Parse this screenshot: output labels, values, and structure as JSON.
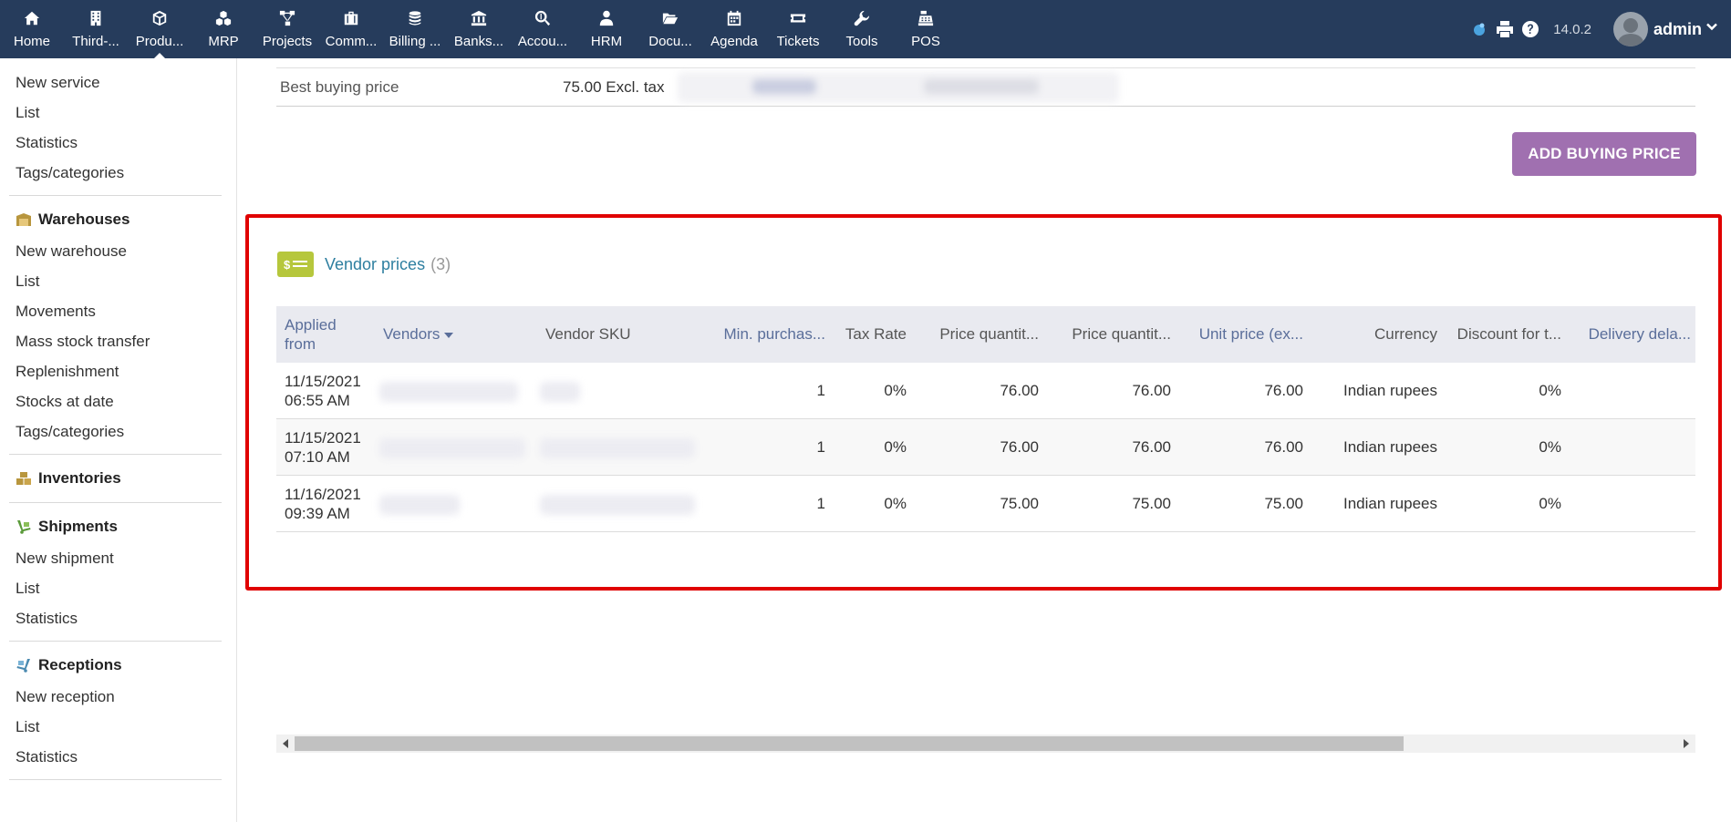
{
  "topbar": {
    "menu": [
      {
        "label": "Home",
        "icon": "home-icon"
      },
      {
        "label": "Third-...",
        "icon": "building-icon"
      },
      {
        "label": "Produ...",
        "icon": "cube-icon",
        "active": true
      },
      {
        "label": "MRP",
        "icon": "cubes-icon"
      },
      {
        "label": "Projects",
        "icon": "sitemap-icon"
      },
      {
        "label": "Comm...",
        "icon": "briefcase-icon"
      },
      {
        "label": "Billing ...",
        "icon": "coins-icon"
      },
      {
        "label": "Banks...",
        "icon": "bank-icon"
      },
      {
        "label": "Accou...",
        "icon": "search-dollar-icon"
      },
      {
        "label": "HRM",
        "icon": "user-tie-icon"
      },
      {
        "label": "Docu...",
        "icon": "folder-open-icon"
      },
      {
        "label": "Agenda",
        "icon": "calendar-icon"
      },
      {
        "label": "Tickets",
        "icon": "ticket-icon"
      },
      {
        "label": "Tools",
        "icon": "wrench-icon"
      },
      {
        "label": "POS",
        "icon": "cash-register-icon"
      }
    ],
    "version": "14.0.2",
    "username": "admin"
  },
  "sidebar": {
    "products": [
      "New service",
      "List",
      "Statistics",
      "Tags/categories"
    ],
    "warehouses": {
      "title": "Warehouses",
      "items": [
        "New warehouse",
        "List",
        "Movements",
        "Mass stock transfer",
        "Replenishment",
        "Stocks at date",
        "Tags/categories"
      ]
    },
    "inventories": {
      "title": "Inventories"
    },
    "shipments": {
      "title": "Shipments",
      "items": [
        "New shipment",
        "List",
        "Statistics"
      ]
    },
    "receptions": {
      "title": "Receptions",
      "items": [
        "New reception",
        "List",
        "Statistics"
      ]
    }
  },
  "best_buying": {
    "label": "Best buying price",
    "value": "75.00 Excl. tax"
  },
  "add_button": "ADD BUYING PRICE",
  "vendor_prices": {
    "title": "Vendor prices",
    "count": "(3)",
    "columns": {
      "applied_from": "Applied from",
      "vendors": "Vendors",
      "vendor_sku": "Vendor SKU",
      "min_purchase": "Min. purchas...",
      "tax_rate": "Tax Rate",
      "price_qty1": "Price quantit...",
      "price_qty2": "Price quantit...",
      "unit_price": "Unit price (ex...",
      "currency": "Currency",
      "discount": "Discount for t...",
      "delivery": "Delivery dela..."
    },
    "rows": [
      {
        "date": "11/15/2021",
        "time": "06:55 AM",
        "min": "1",
        "tax": "0%",
        "pq1": "76.00",
        "pq2": "76.00",
        "unit": "76.00",
        "currency": "Indian rupees",
        "discount": "0%"
      },
      {
        "date": "11/15/2021",
        "time": "07:10 AM",
        "min": "1",
        "tax": "0%",
        "pq1": "76.00",
        "pq2": "76.00",
        "unit": "76.00",
        "currency": "Indian rupees",
        "discount": "0%"
      },
      {
        "date": "11/16/2021",
        "time": "09:39 AM",
        "min": "1",
        "tax": "0%",
        "pq1": "75.00",
        "pq2": "75.00",
        "unit": "75.00",
        "currency": "Indian rupees",
        "discount": "0%"
      }
    ]
  },
  "colors": {
    "topbar": "#263c5c",
    "accent_button": "#a070b0",
    "link": "#2e7fa0",
    "highlight": "#e00000",
    "section_icon": "#b6c73c"
  }
}
